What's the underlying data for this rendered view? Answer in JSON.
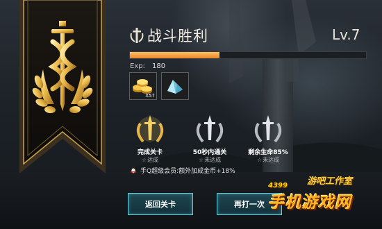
{
  "header": {
    "title": "战斗胜利",
    "level": "Lv.7",
    "exp_label": "Exp:",
    "exp_value": "180",
    "exp_progress": 0.38
  },
  "rewards": [
    {
      "icon": "gold-coins-icon",
      "count": "X57"
    },
    {
      "icon": "crystal-shard-icon",
      "count": ""
    }
  ],
  "achievements": [
    {
      "title": "完成关卡",
      "status": "达成",
      "achieved": true
    },
    {
      "title": "50秒内通关",
      "status": "未达成",
      "achieved": false
    },
    {
      "title": "剩余生命85%",
      "status": "未达成",
      "achieved": false
    }
  ],
  "vip": {
    "text": "手Q超级会员:额外加成金币+18%"
  },
  "buttons": {
    "back": "返回关卡",
    "replay": "再打一次"
  },
  "watermark": {
    "num": "4399",
    "line1": "游吧工作室",
    "line2": "手机游戏网"
  },
  "colors": {
    "accent": "#f0a040",
    "button_border": "#63d3e3",
    "gold": "#f3c45a"
  }
}
